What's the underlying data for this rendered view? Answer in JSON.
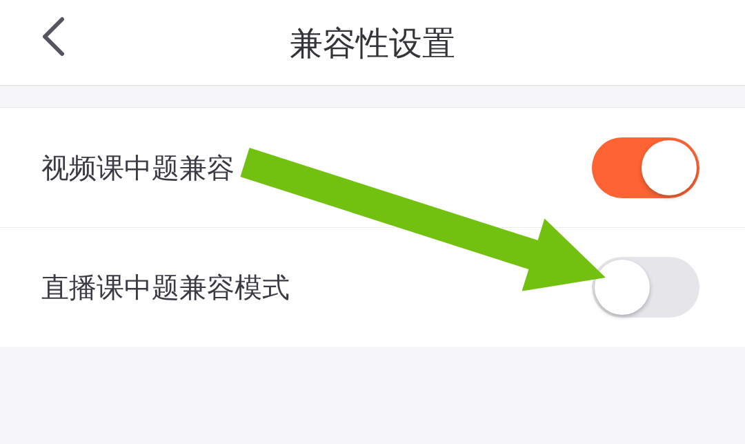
{
  "header": {
    "title": "兼容性设置"
  },
  "settings": [
    {
      "label": "视频课中题兼容",
      "on": true
    },
    {
      "label": "直播课中题兼容模式",
      "on": false
    }
  ]
}
